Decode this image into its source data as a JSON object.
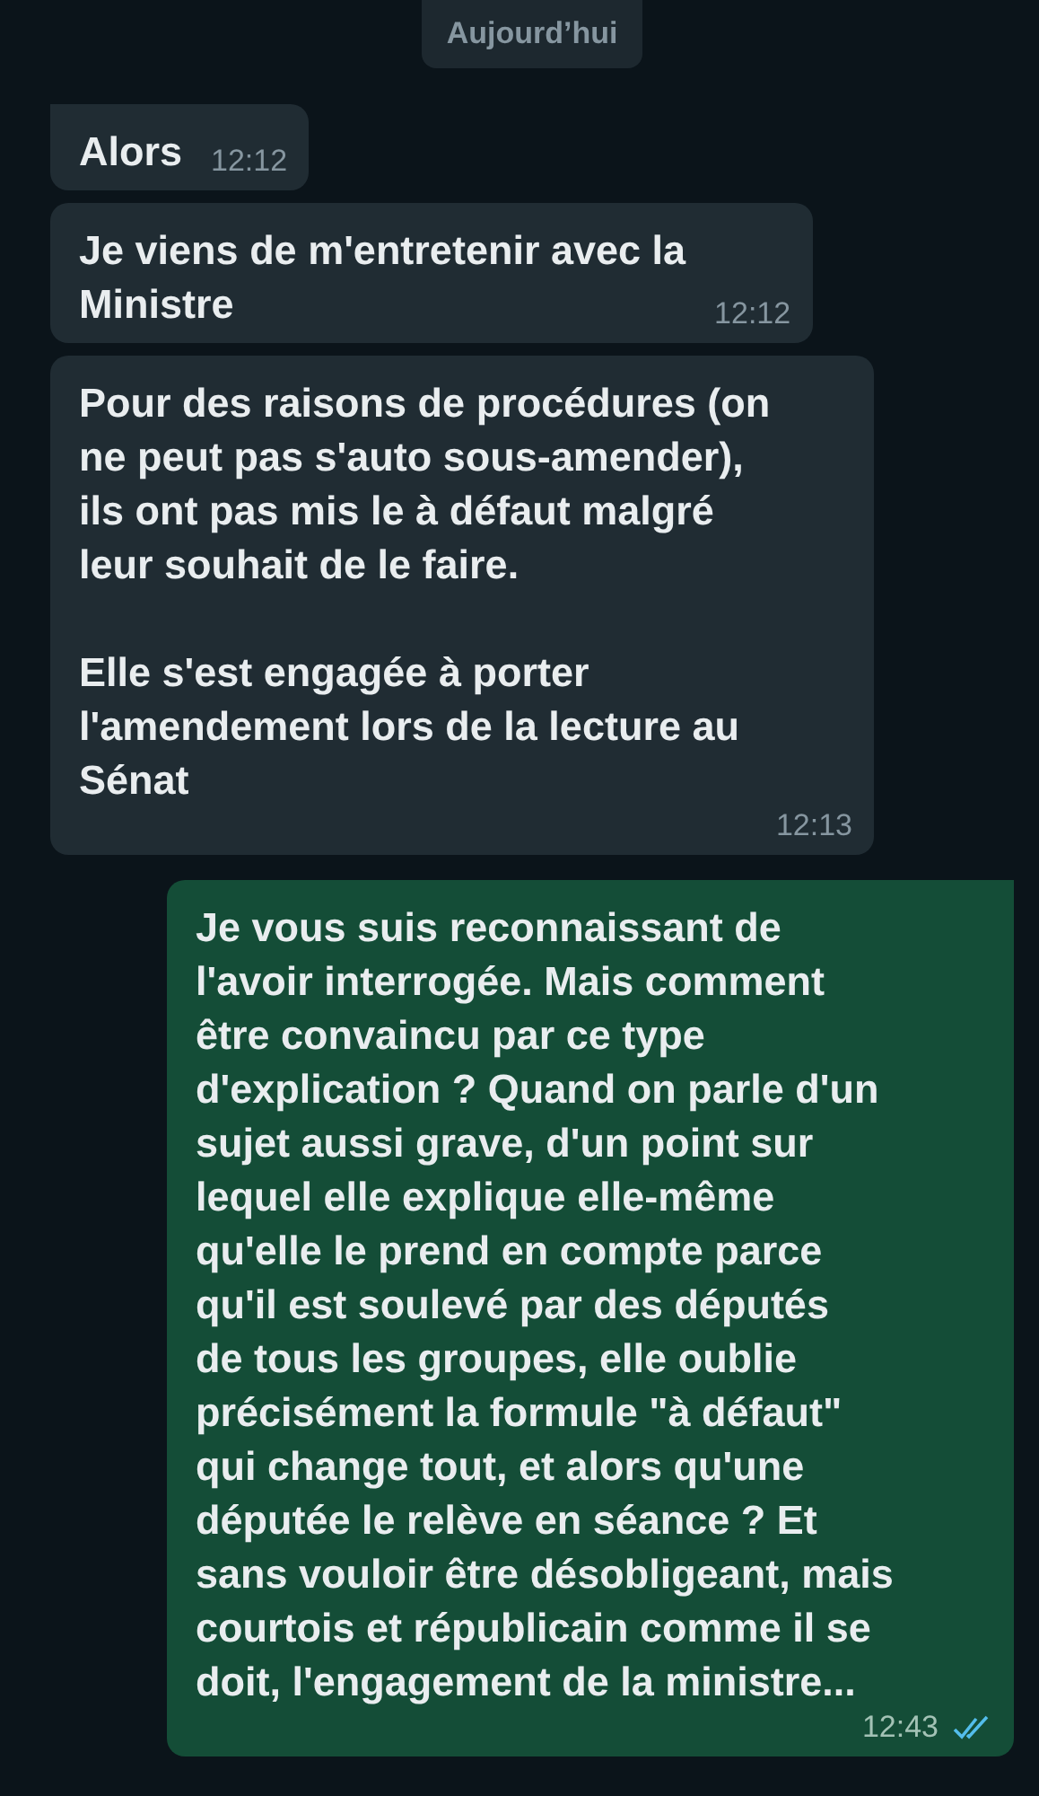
{
  "date_separator": "Aujourd’hui",
  "messages": [
    {
      "kind": "incoming",
      "text": "Alors",
      "time": "12:12"
    },
    {
      "kind": "incoming",
      "text": "Je viens de m'entretenir avec la\nMinistre",
      "time": "12:12"
    },
    {
      "kind": "incoming",
      "text": "Pour des raisons de procédures (on\nne peut pas s'auto sous-amender),\nils ont pas mis le à défaut malgré\nleur souhait de le faire.\n\nElle s'est engagée à porter\nl'amendement lors de la lecture au\nSénat",
      "time": "12:13"
    },
    {
      "kind": "outgoing",
      "text": "Je vous suis reconnaissant de\nl'avoir interrogée. Mais comment\nêtre convaincu par ce type\nd'explication ? Quand on parle d'un\nsujet aussi grave, d'un point sur\nlequel elle explique elle-même\nqu'elle le prend en compte parce\nqu'il est soulevé par des députés\nde tous les groupes, elle oublie\nprécisément la formule \"à défaut\"\nqui change tout, et alors qu'une\ndéputée le relève en séance ? Et\nsans vouloir être désobligeant, mais\ncourtois et républicain comme il se\ndoit, l'engagement de la ministre...",
      "time": "12:43",
      "read": true
    }
  ]
}
